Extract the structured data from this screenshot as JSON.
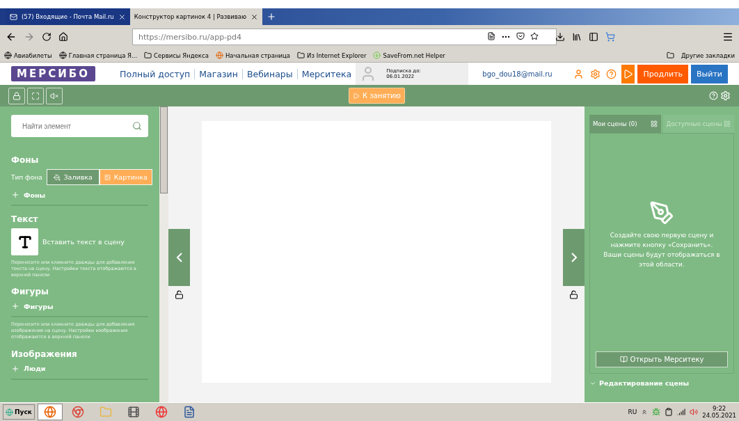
{
  "browser": {
    "tabs": [
      {
        "label": "(57) Входящие - Почта Mail.ru",
        "selected": false,
        "kind": "mail"
      },
      {
        "label": "Конструктор картинок 4 | Развиваю",
        "selected": true,
        "kind": "page"
      }
    ],
    "url_host": "https://mersibo.ru",
    "url_path": "/app-pd4",
    "bookmarks": [
      {
        "label": "Авиабилеты",
        "kind": "globe"
      },
      {
        "label": "Главная страница Я...",
        "kind": "globe"
      },
      {
        "label": "Сервисы Яндекса",
        "kind": "folder"
      },
      {
        "label": "Начальная страница",
        "kind": "firefox"
      },
      {
        "label": "Из Internet Explorer",
        "kind": "folder"
      },
      {
        "label": "SaveFrom.net Helper",
        "kind": "download"
      }
    ],
    "other_bookmarks": "Другие закладки"
  },
  "site": {
    "logo": "МЕРСИБО",
    "nav": [
      "Полный доступ",
      "Магазин",
      "Вебинары",
      "Мерситека"
    ],
    "subscription_label": "Подписка до:",
    "subscription_date": "06.01.2022",
    "email": "bgo_dou18@mail.ru",
    "extend_button": "Продлить",
    "logout_button": "Выйти"
  },
  "toolbar": {
    "lesson_button": "К занятию"
  },
  "left_panel": {
    "search_placeholder": "Найти элемент",
    "sections": [
      {
        "kind": "backgrounds",
        "title": "Фоны",
        "type_label": "Тип фона",
        "options": [
          {
            "label": "Заливка",
            "selected": false
          },
          {
            "label": "Картинка",
            "selected": true
          }
        ],
        "items": [
          "Фоны"
        ]
      },
      {
        "kind": "text",
        "title": "Текст",
        "insert_label": "Вставить текст в сцену",
        "hint": "Перенесите или кликните дважды для добавления текста на сцену. Настройки текста отображаются в верхней панели"
      },
      {
        "kind": "shapes",
        "title": "Фигуры",
        "items": [
          "Фигуры"
        ],
        "hint": "Перенесите или кликните дважды для добавления изображения на сцену. Настройки изображения отображаются в верхней панели"
      },
      {
        "kind": "images",
        "title": "Изображения",
        "items": [
          "Люди"
        ]
      }
    ]
  },
  "right_panel": {
    "tabs": [
      {
        "label": "Мои сцены (0)",
        "selected": true
      },
      {
        "label": "Доступные сцены",
        "selected": false
      }
    ],
    "empty_message": "Создайте свою первую сцену и нажмите кнопку «Сохранить». Ваши сцены будут отображаться в этой области.",
    "open_button": "Открыть Мерситеку",
    "edit_section": {
      "title": "Редактирование сцены",
      "expanded": true
    }
  },
  "taskbar": {
    "start": "Пуск",
    "apps": [
      {
        "kind": "firefox",
        "selected": true
      },
      {
        "kind": "chrome",
        "selected": false
      },
      {
        "kind": "folder",
        "selected": false
      },
      {
        "kind": "media",
        "selected": false
      },
      {
        "kind": "yandex",
        "selected": false
      },
      {
        "kind": "word",
        "selected": false
      }
    ],
    "language": "RU",
    "time": "9:22",
    "date": "24.05.2021"
  }
}
